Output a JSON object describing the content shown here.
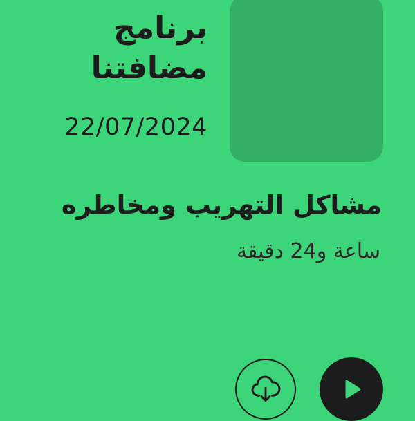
{
  "program": {
    "title": "برنامج مضافتنا",
    "date": "22/07/2024"
  },
  "episode": {
    "title": "مشاكل التهريب ومخاطره",
    "duration": "ساعة و24 دقيقة"
  },
  "icons": {
    "download": "cloud-download-icon",
    "play": "play-icon"
  },
  "colors": {
    "background": "#3dd57a",
    "artwork_placeholder": "#33b066",
    "text": "#1c1c1c"
  }
}
